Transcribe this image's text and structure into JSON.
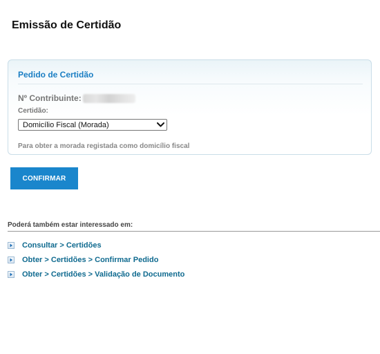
{
  "page": {
    "title": "Emissão de Certidão"
  },
  "panel": {
    "title": "Pedido de Certidão",
    "contribuinte_label": "Nº Contribuinte:",
    "certidao_label": "Certidão:",
    "certidao_selected": "Domicílio Fiscal (Morada)",
    "hint": "Para obter a morada registada como domicílio fiscal"
  },
  "actions": {
    "confirm_label": "CONFIRMAR"
  },
  "related": {
    "title": "Poderá também estar interessado em:",
    "links": [
      {
        "label": "Consultar > Certidões"
      },
      {
        "label": "Obter > Certidões > Confirmar Pedido"
      },
      {
        "label": "Obter > Certidões > Validação de Documento"
      }
    ]
  },
  "colors": {
    "accent": "#1a86cc",
    "panel_title": "#1a7ec3",
    "link": "#0f6a8f"
  },
  "icons": {
    "select": "chevron-down-icon",
    "link_bullet": "arrow-right-icon"
  }
}
